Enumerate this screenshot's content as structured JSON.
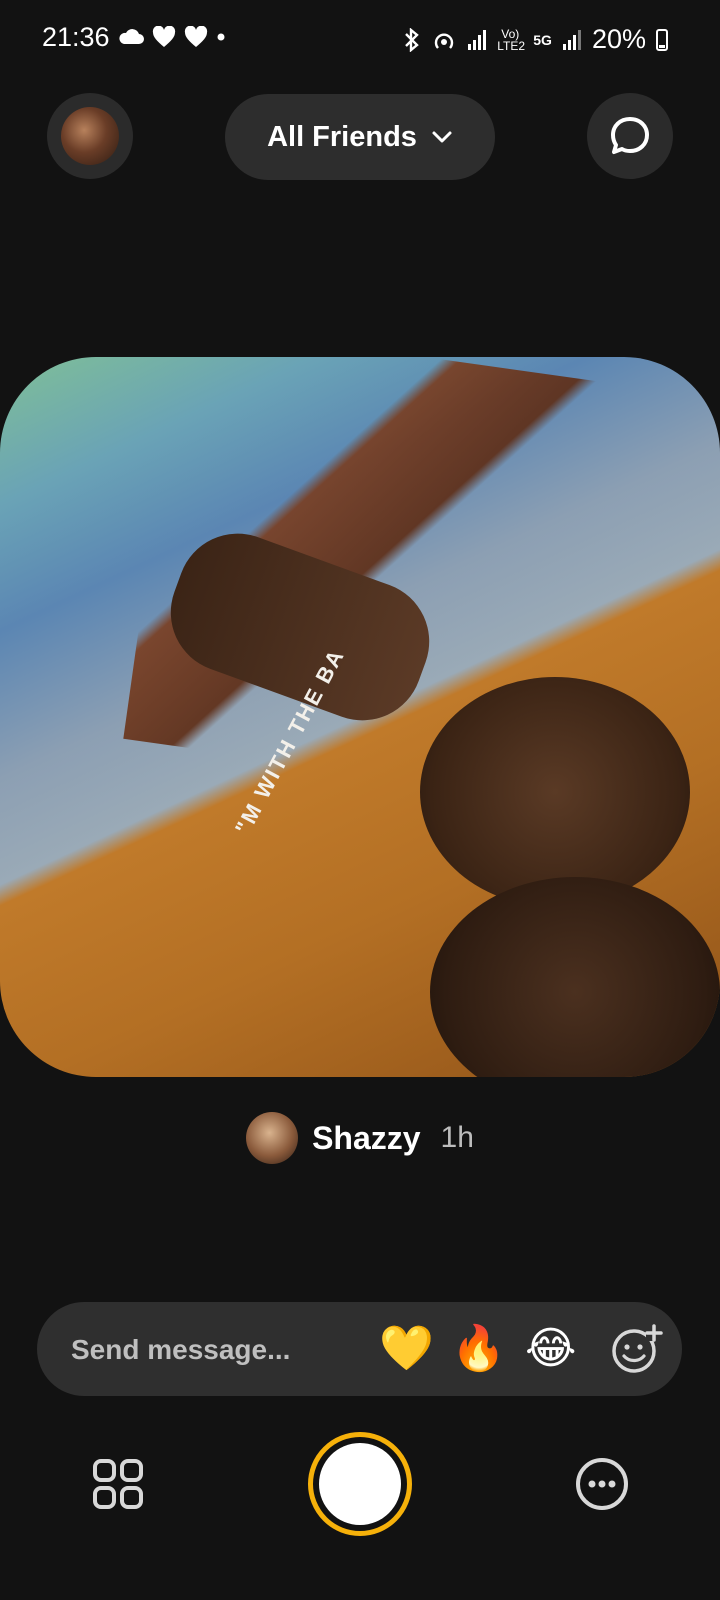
{
  "status_bar": {
    "time": "21:36",
    "network": "5G",
    "volte": "Vo) LTE2",
    "battery": "20%"
  },
  "top_bar": {
    "friends_filter": "All Friends"
  },
  "photo": {
    "caption_text": "\"M WITH THE BA"
  },
  "post": {
    "author": "Shazzy",
    "time_ago": "1h"
  },
  "message": {
    "placeholder": "Send message...",
    "reactions": [
      "💛",
      "🔥",
      "😂"
    ]
  },
  "colors": {
    "background": "#121212",
    "pill": "#2d2d2d",
    "shutter_ring": "#f6b10a"
  }
}
